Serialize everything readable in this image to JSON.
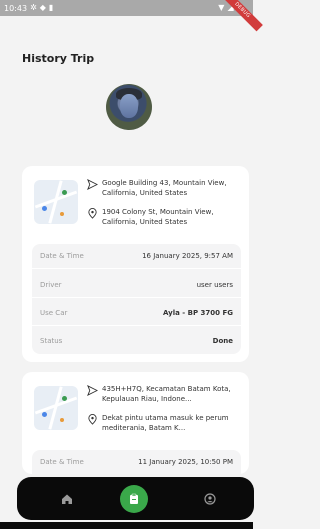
{
  "status_bar": {
    "time": "10:43"
  },
  "debug_banner": "DEBUG",
  "page": {
    "title": "History Trip"
  },
  "trips": [
    {
      "pickup": "Google Building 43, Mountain View, California, United States",
      "dropoff": "1904 Colony St, Mountain View, California, United States",
      "details": {
        "datetime_label": "Date & Time",
        "datetime_value": "16 January 2025, 9:57 AM",
        "driver_label": "Driver",
        "driver_value": "user users",
        "car_label": "Use Car",
        "car_value": "Ayla - BP 3700 FG",
        "status_label": "Status",
        "status_value": "Done"
      }
    },
    {
      "pickup": "435H+H7Q, Kecamatan Batam Kota, Kepulauan Riau, Indone...",
      "dropoff": "Dekat pintu utama masuk ke perum mediterania, Batam K...",
      "details": {
        "datetime_label": "Date & Time",
        "datetime_value": "11 January 2025, 10:50 PM"
      }
    }
  ],
  "nav": {
    "items": [
      {
        "name": "home",
        "icon": "home-icon"
      },
      {
        "name": "history",
        "icon": "document-icon"
      },
      {
        "name": "profile",
        "icon": "user-icon"
      }
    ],
    "active_color": "#3aa84a"
  },
  "colors": {
    "accent": "#3aa84a",
    "debug": "#d13b3b"
  }
}
